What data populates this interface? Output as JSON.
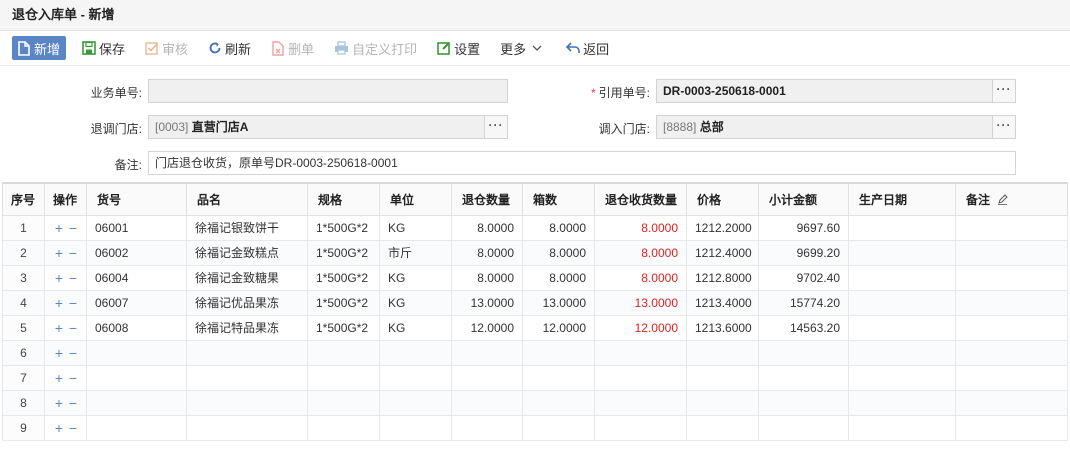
{
  "window": {
    "title": "退仓入库单 - 新增"
  },
  "toolbar": {
    "new": "新增",
    "save": "保存",
    "audit": "审核",
    "refresh": "刷新",
    "delete": "删单",
    "print": "自定义打印",
    "settings": "设置",
    "more": "更多",
    "back": "返回"
  },
  "form": {
    "biz_no_label": "业务单号:",
    "biz_no_value": "",
    "ref_no_label": "引用单号:",
    "ref_no_required": "*",
    "ref_no_value": "DR-0003-250618-0001",
    "out_store_label": "退调门店:",
    "out_store_code": "[0003]",
    "out_store_name": "直营门店A",
    "in_store_label": "调入门店:",
    "in_store_code": "[8888]",
    "in_store_name": "总部",
    "remark_label": "备注:",
    "remark_value": "门店退仓收货，原单号DR-0003-250618-0001",
    "lookup_symbol": "···"
  },
  "grid": {
    "headers": {
      "idx": "序号",
      "ops": "操作",
      "code": "货号",
      "name": "品名",
      "spec": "规格",
      "unit": "单位",
      "qty": "退仓数量",
      "boxes": "箱数",
      "recv_qty": "退仓收货数量",
      "price": "价格",
      "amount": "小计金额",
      "prod_date": "生产日期",
      "remark": "备注"
    },
    "add_symbol": "+",
    "remove_symbol": "−",
    "rows": [
      {
        "idx": "1",
        "code": "06001",
        "name": "徐福记银致饼干",
        "spec": "1*500G*2",
        "unit": "KG",
        "qty": "8.0000",
        "boxes": "8.0000",
        "recv_qty": "8.0000",
        "price": "1212.2000",
        "amount": "9697.60",
        "prod_date": "",
        "remark": ""
      },
      {
        "idx": "2",
        "code": "06002",
        "name": "徐福记金致糕点",
        "spec": "1*500G*2",
        "unit": "市斤",
        "qty": "8.0000",
        "boxes": "8.0000",
        "recv_qty": "8.0000",
        "price": "1212.4000",
        "amount": "9699.20",
        "prod_date": "",
        "remark": ""
      },
      {
        "idx": "3",
        "code": "06004",
        "name": "徐福记金致糖果",
        "spec": "1*500G*2",
        "unit": "KG",
        "qty": "8.0000",
        "boxes": "8.0000",
        "recv_qty": "8.0000",
        "price": "1212.8000",
        "amount": "9702.40",
        "prod_date": "",
        "remark": ""
      },
      {
        "idx": "4",
        "code": "06007",
        "name": "徐福记优品果冻",
        "spec": "1*500G*2",
        "unit": "KG",
        "qty": "13.0000",
        "boxes": "13.0000",
        "recv_qty": "13.0000",
        "price": "1213.4000",
        "amount": "15774.20",
        "prod_date": "",
        "remark": ""
      },
      {
        "idx": "5",
        "code": "06008",
        "name": "徐福记特品果冻",
        "spec": "1*500G*2",
        "unit": "KG",
        "qty": "12.0000",
        "boxes": "12.0000",
        "recv_qty": "12.0000",
        "price": "1213.6000",
        "amount": "14563.20",
        "prod_date": "",
        "remark": ""
      },
      {
        "idx": "6",
        "code": "",
        "name": "",
        "spec": "",
        "unit": "",
        "qty": "",
        "boxes": "",
        "recv_qty": "",
        "price": "",
        "amount": "",
        "prod_date": "",
        "remark": ""
      },
      {
        "idx": "7",
        "code": "",
        "name": "",
        "spec": "",
        "unit": "",
        "qty": "",
        "boxes": "",
        "recv_qty": "",
        "price": "",
        "amount": "",
        "prod_date": "",
        "remark": ""
      },
      {
        "idx": "8",
        "code": "",
        "name": "",
        "spec": "",
        "unit": "",
        "qty": "",
        "boxes": "",
        "recv_qty": "",
        "price": "",
        "amount": "",
        "prod_date": "",
        "remark": ""
      },
      {
        "idx": "9",
        "code": "",
        "name": "",
        "spec": "",
        "unit": "",
        "qty": "",
        "boxes": "",
        "recv_qty": "",
        "price": "",
        "amount": "",
        "prod_date": "",
        "remark": ""
      }
    ]
  },
  "colors": {
    "accent": "#5b86c5",
    "received_qty": "#e02222",
    "required": "#e23b3b"
  }
}
